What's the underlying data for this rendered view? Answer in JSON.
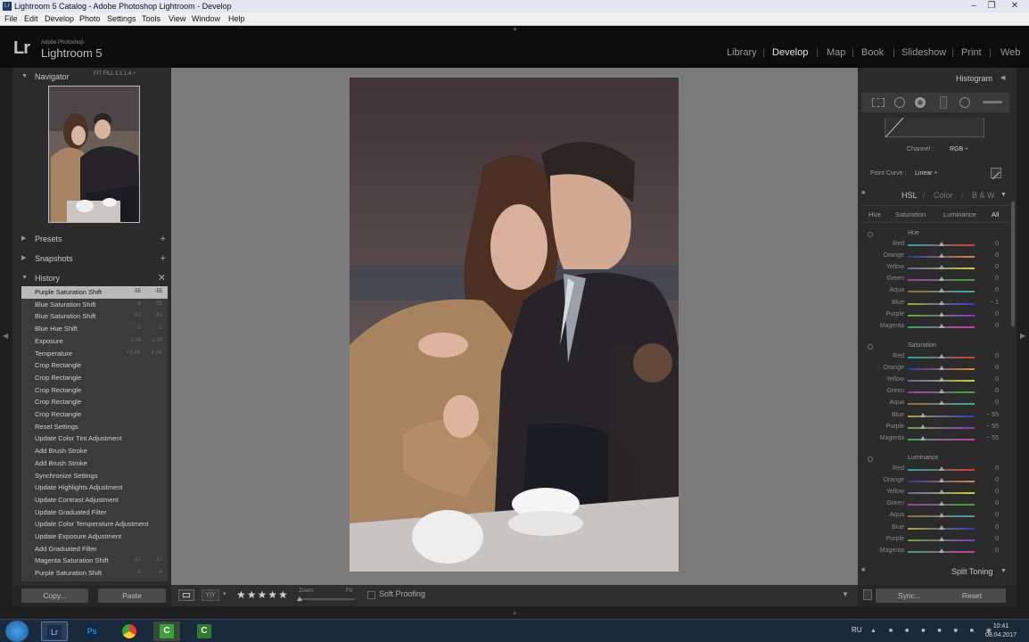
{
  "window": {
    "title": "Lightroom 5 Catalog - Adobe Photoshop Lightroom - Develop"
  },
  "menu": [
    "File",
    "Edit",
    "Develop",
    "Photo",
    "Settings",
    "Tools",
    "View",
    "Window",
    "Help"
  ],
  "identity": {
    "mark": "Lr",
    "vendor": "Adobe Photoshop",
    "product": "Lightroom 5"
  },
  "modules": [
    "Library",
    "Develop",
    "Map",
    "Book",
    "Slideshow",
    "Print",
    "Web"
  ],
  "active_module": "Develop",
  "left": {
    "navigator": {
      "title": "Navigator",
      "options": "FIT   FILL   1:1   1:4 ÷"
    },
    "presets": "Presets",
    "snapshots": "Snapshots",
    "history": {
      "title": "History",
      "items": [
        {
          "label": "Purple Saturation Shift",
          "v1": "-55",
          "v2": "-55",
          "selected": true
        },
        {
          "label": "Blue Saturation Shift",
          "v1": "-8",
          "v2": "-55"
        },
        {
          "label": "Blue Saturation Shift",
          "v1": "-63",
          "v2": "-63"
        },
        {
          "label": "Blue Hue Shift",
          "v1": "-1",
          "v2": "-1"
        },
        {
          "label": "Exposure",
          "v1": "-1.26",
          "v2": "-1.26"
        },
        {
          "label": "Temperature",
          "v1": "+5.6K",
          "v2": "6.6K"
        },
        {
          "label": "Crop Rectangle",
          "v1": "",
          "v2": ""
        },
        {
          "label": "Crop Rectangle",
          "v1": "",
          "v2": ""
        },
        {
          "label": "Crop Rectangle",
          "v1": "",
          "v2": ""
        },
        {
          "label": "Crop Rectangle",
          "v1": "",
          "v2": ""
        },
        {
          "label": "Crop Rectangle",
          "v1": "",
          "v2": ""
        },
        {
          "label": "Reset Settings",
          "v1": "",
          "v2": ""
        },
        {
          "label": "Update Color Tint Adjustment",
          "v1": "",
          "v2": ""
        },
        {
          "label": "Add Brush Stroke",
          "v1": "",
          "v2": ""
        },
        {
          "label": "Add Brush Stroke",
          "v1": "",
          "v2": ""
        },
        {
          "label": "Synchronize Settings",
          "v1": "",
          "v2": ""
        },
        {
          "label": "Update Highlights Adjustment",
          "v1": "",
          "v2": ""
        },
        {
          "label": "Update Contrast Adjustment",
          "v1": "",
          "v2": ""
        },
        {
          "label": "Update Graduated Filter",
          "v1": "",
          "v2": ""
        },
        {
          "label": "Update Color Temperature Adjustment",
          "v1": "",
          "v2": ""
        },
        {
          "label": "Update Exposure Adjustment",
          "v1": "",
          "v2": ""
        },
        {
          "label": "Add Graduated Filter",
          "v1": "",
          "v2": ""
        },
        {
          "label": "Magenta Saturation Shift",
          "v1": "-57",
          "v2": "-57"
        },
        {
          "label": "Purple Saturation Shift",
          "v1": "-6",
          "v2": "-6"
        }
      ]
    },
    "copy_label": "Copy...",
    "paste_label": "Paste"
  },
  "toolbar": {
    "rating": "★★★★★",
    "zoom_label": "Zoom",
    "zoom_value": "Fit",
    "soft_proofing": "Soft Proofing"
  },
  "right": {
    "histogram": "Histogram",
    "channel_label": "Channel :",
    "channel_value": "RGB ÷",
    "point_curve_label": "Point Curve :",
    "point_curve_value": "Linear ÷",
    "hsl_tabs": [
      "HSL",
      "Color",
      "B & W"
    ],
    "sub_tabs": [
      "Hue",
      "Saturation",
      "Luminance",
      "All"
    ],
    "groups": [
      {
        "name": "Hue",
        "rows": [
          {
            "label": "Red",
            "value": "0"
          },
          {
            "label": "Orange",
            "value": "0"
          },
          {
            "label": "Yellow",
            "value": "0"
          },
          {
            "label": "Green",
            "value": "0"
          },
          {
            "label": "Aqua",
            "value": "0"
          },
          {
            "label": "Blue",
            "value": "− 1"
          },
          {
            "label": "Purple",
            "value": "0"
          },
          {
            "label": "Magenta",
            "value": "0"
          }
        ]
      },
      {
        "name": "Saturation",
        "rows": [
          {
            "label": "Red",
            "value": "0"
          },
          {
            "label": "Orange",
            "value": "0"
          },
          {
            "label": "Yellow",
            "value": "0"
          },
          {
            "label": "Green",
            "value": "0"
          },
          {
            "label": "Aqua",
            "value": "0"
          },
          {
            "label": "Blue",
            "value": "− 55"
          },
          {
            "label": "Purple",
            "value": "− 55"
          },
          {
            "label": "Magenta",
            "value": "− 55"
          }
        ]
      },
      {
        "name": "Luminance",
        "rows": [
          {
            "label": "Red",
            "value": "0"
          },
          {
            "label": "Orange",
            "value": "0"
          },
          {
            "label": "Yellow",
            "value": "0"
          },
          {
            "label": "Green",
            "value": "0"
          },
          {
            "label": "Aqua",
            "value": "0"
          },
          {
            "label": "Blue",
            "value": "0"
          },
          {
            "label": "Purple",
            "value": "0"
          },
          {
            "label": "Magenta",
            "value": "0"
          }
        ]
      }
    ],
    "split_toning": "Split Toning",
    "sync_label": "Sync...",
    "reset_label": "Reset"
  },
  "taskbar": {
    "lang": "RU",
    "time": "10:41",
    "date": "08.04.2017"
  }
}
